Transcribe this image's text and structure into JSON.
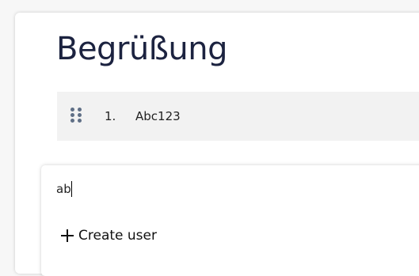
{
  "page": {
    "title": "Begrüßung"
  },
  "list": {
    "items": [
      {
        "index": "1.",
        "label": "Abc123"
      }
    ]
  },
  "dropdown": {
    "search_value": "ab",
    "create_label": "Create user",
    "create_icon": "plus-icon"
  },
  "colors": {
    "title": "#1c2340",
    "row_background": "#f2f2f2",
    "drag_handle": "#5f6f86"
  }
}
